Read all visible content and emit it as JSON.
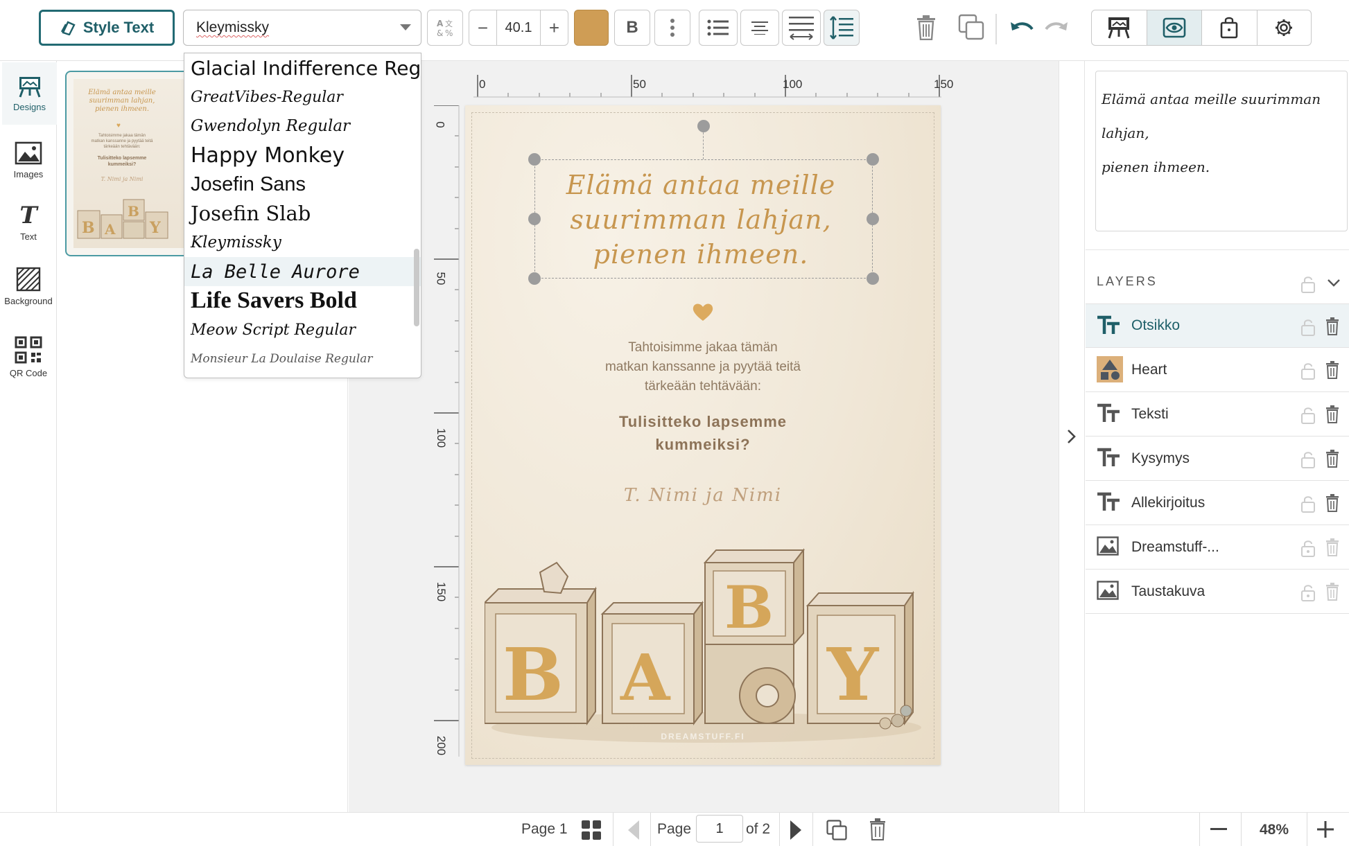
{
  "toolbar": {
    "style_text_label": "Style Text",
    "font_value": "Kleymissky",
    "font_size": "40.1",
    "size_minus": "−",
    "size_plus": "+",
    "text_color": "#cf9d55",
    "bold_label": "B"
  },
  "font_dropdown": {
    "options": [
      "Glacial Indifference Reg",
      "GreatVibes-Regular",
      "Gwendolyn Regular",
      "Happy Monkey",
      "Josefin Sans",
      "Josefin Slab",
      "Kleymissky",
      "La Belle Aurore",
      "Life Savers Bold",
      "Meow Script Regular",
      "Monsieur La Doulaise Regular"
    ],
    "highlighted": "La Belle Aurore"
  },
  "rail": {
    "designs": "Designs",
    "images": "Images",
    "text": "Text",
    "background": "Background",
    "qr": "QR Code"
  },
  "ruler": {
    "h": [
      "0",
      "50",
      "100",
      "150"
    ],
    "v": [
      "0",
      "50",
      "100",
      "150",
      "200"
    ]
  },
  "card": {
    "headline_1": "Elämä antaa meille",
    "headline_2": "suurimman lahjan,",
    "headline_3": "pienen ihmeen.",
    "body_1": "Tahtoisimme jakaa tämän",
    "body_2": "matkan kanssanne ja pyytää teitä",
    "body_3": "tärkeään tehtävään:",
    "question_1": "Tulisitteko lapsemme",
    "question_2": "kummeiksi?",
    "signature": "T. Nimi ja Nimi",
    "watermark": "DREAMSTUFF.FI",
    "blocks": [
      "B",
      "A",
      "B",
      "Y"
    ]
  },
  "right_panel": {
    "preview_1": "Elämä antaa meille suurimman",
    "preview_2": "lahjan,",
    "preview_3": "pienen ihmeen.",
    "layers_title": "LAYERS",
    "layers": [
      "Otsikko",
      "Heart",
      "Teksti",
      "Kysymys",
      "Allekirjoitus",
      "Dreamstuff-...",
      "Taustakuva"
    ]
  },
  "bottom": {
    "page_label": "Page 1",
    "page_word": "Page",
    "page_value": "1",
    "of_label": "of 2",
    "zoom": "48%"
  },
  "colors": {
    "accent": "#226a73",
    "gold": "#c7964f"
  }
}
